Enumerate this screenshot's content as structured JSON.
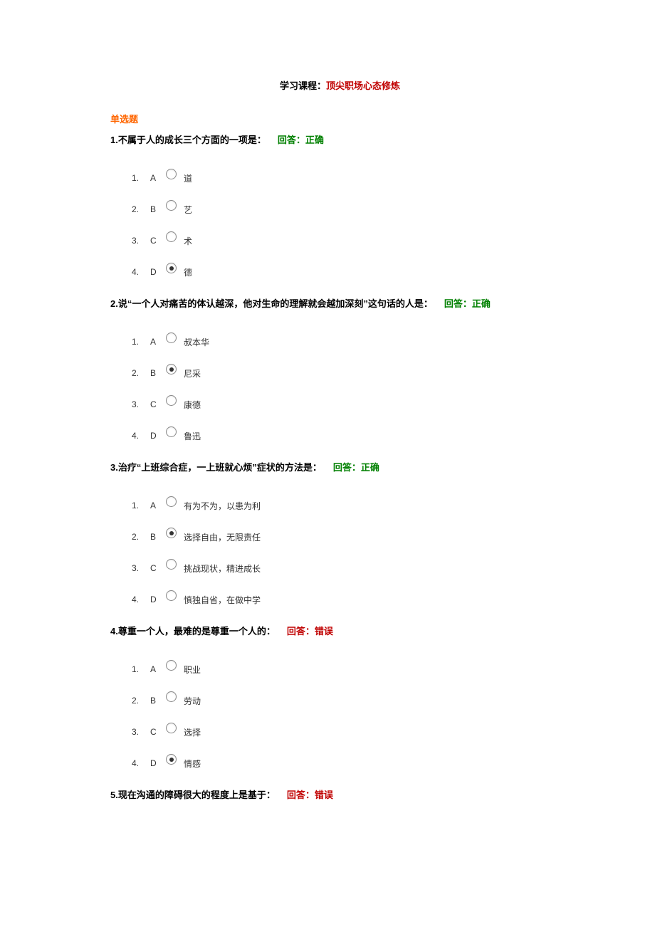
{
  "course": {
    "label": "学习课程：",
    "name": "顶尖职场心态修炼"
  },
  "section_title": "单选题",
  "answer_label": "回答：",
  "correct_text": "正确",
  "wrong_text": "错误",
  "questions": [
    {
      "number": "1.",
      "text": "不属于人的成长三个方面的一项是：",
      "status": "correct",
      "options": [
        {
          "num": "1.",
          "letter": "A",
          "text": "道",
          "selected": false
        },
        {
          "num": "2.",
          "letter": "B",
          "text": "艺",
          "selected": false
        },
        {
          "num": "3.",
          "letter": "C",
          "text": "术",
          "selected": false
        },
        {
          "num": "4.",
          "letter": "D",
          "text": "德",
          "selected": true
        }
      ]
    },
    {
      "number": "2.",
      "text": "说“一个人对痛苦的体认越深，他对生命的理解就会越加深刻”这句话的人是：",
      "status": "correct",
      "options": [
        {
          "num": "1.",
          "letter": "A",
          "text": "叔本华",
          "selected": false
        },
        {
          "num": "2.",
          "letter": "B",
          "text": "尼采",
          "selected": true
        },
        {
          "num": "3.",
          "letter": "C",
          "text": "康德",
          "selected": false
        },
        {
          "num": "4.",
          "letter": "D",
          "text": "鲁迅",
          "selected": false
        }
      ]
    },
    {
      "number": "3.",
      "text": "治疗“上班综合症，一上班就心烦”症状的方法是：",
      "status": "correct",
      "options": [
        {
          "num": "1.",
          "letter": "A",
          "text": "有为不为，以患为利",
          "selected": false
        },
        {
          "num": "2.",
          "letter": "B",
          "text": "选择自由，无限责任",
          "selected": true
        },
        {
          "num": "3.",
          "letter": "C",
          "text": "挑战现状，精进成长",
          "selected": false
        },
        {
          "num": "4.",
          "letter": "D",
          "text": "慎独自省，在做中学",
          "selected": false
        }
      ]
    },
    {
      "number": "4.",
      "text": "尊重一个人，最难的是尊重一个人的：",
      "status": "wrong",
      "options": [
        {
          "num": "1.",
          "letter": "A",
          "text": "职业",
          "selected": false
        },
        {
          "num": "2.",
          "letter": "B",
          "text": "劳动",
          "selected": false
        },
        {
          "num": "3.",
          "letter": "C",
          "text": "选择",
          "selected": false
        },
        {
          "num": "4.",
          "letter": "D",
          "text": "情感",
          "selected": true
        }
      ]
    },
    {
      "number": "5.",
      "text": "现在沟通的障碍很大的程度上是基于：",
      "status": "wrong",
      "options": []
    }
  ]
}
